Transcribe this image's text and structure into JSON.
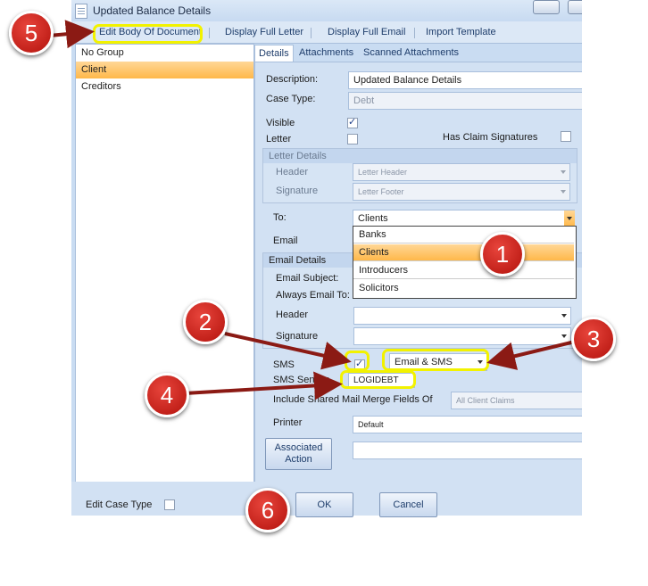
{
  "window": {
    "title": "Updated Balance Details"
  },
  "toolbar": {
    "edit_body": "Edit Body Of Document",
    "display_letter": "Display Full Letter",
    "display_email": "Display Full Email",
    "import_template": "Import Template"
  },
  "groups": {
    "items": [
      "No Group",
      "Client",
      "Creditors"
    ],
    "selected": "Client"
  },
  "tabs": [
    "Details",
    "Attachments",
    "Scanned Attachments"
  ],
  "details": {
    "description_label": "Description:",
    "description_value": "Updated Balance Details",
    "case_type_label": "Case Type:",
    "case_type_value": "Debt",
    "visible_label": "Visible",
    "letter_label": "Letter",
    "has_claim_label": "Has Claim Signatures"
  },
  "letter_details": {
    "legend": "Letter Details",
    "header_label": "Header",
    "header_value": "Letter Header",
    "signature_label": "Signature",
    "signature_value": "Letter Footer"
  },
  "to": {
    "label": "To:",
    "value": "Clients",
    "options": [
      "Banks",
      "Clients",
      "Introducers",
      "Solicitors"
    ]
  },
  "email_label": "Email",
  "email_details": {
    "legend": "Email Details",
    "subject_label": "Email Subject:",
    "always_label": "Always Email To:",
    "header_label": "Header",
    "signature_label": "Signature"
  },
  "sms": {
    "label": "SMS",
    "mode": "Email & SMS",
    "sender_label": "SMS Sender",
    "sender_value": "LOGIDEBT"
  },
  "merge": {
    "label": "Include Shared Mail Merge Fields Of",
    "value": "All Client Claims"
  },
  "printer": {
    "label": "Printer",
    "value": "Default"
  },
  "associated_action": {
    "line1": "Associated",
    "line2": "Action"
  },
  "footer": {
    "edit_case_type": "Edit Case Type",
    "ok": "OK",
    "cancel": "Cancel"
  },
  "callouts": [
    "1",
    "2",
    "3",
    "4",
    "5",
    "6"
  ],
  "colors": {
    "callout": "#c8150f",
    "highlight": "#f2f200",
    "selection": "#ffb84a"
  }
}
